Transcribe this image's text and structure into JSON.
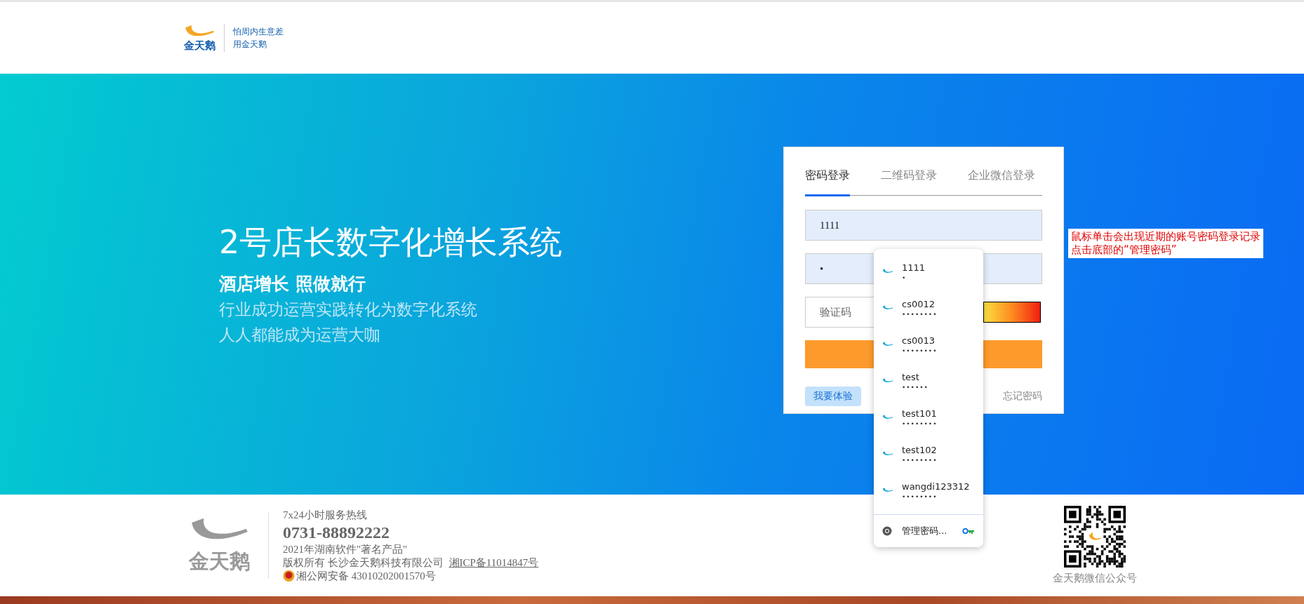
{
  "header": {
    "logo_text": "金天鹅",
    "slogan_lines": [
      "怕周内生意差",
      "用金天鹅"
    ]
  },
  "hero": {
    "title": "2号店长数字化增长系统",
    "subtitle": "酒店增长 照做就行",
    "lines": [
      "行业成功运营实践转化为数字化系统",
      "人人都能成为运营大咖"
    ]
  },
  "login": {
    "tabs": [
      {
        "label": "密码登录",
        "selected": true
      },
      {
        "label": "二维码登录",
        "selected": false
      },
      {
        "label": "企业微信登录",
        "selected": false
      }
    ],
    "username": {
      "value": "1111"
    },
    "password": {
      "value": "•"
    },
    "captcha": {
      "placeholder": "验证码"
    },
    "trial_button": "我要体验",
    "forgot_link": "忘记密码"
  },
  "autofill": {
    "items": [
      {
        "username": "1111",
        "password": "•"
      },
      {
        "username": "cs0012",
        "password": "••••••••"
      },
      {
        "username": "cs0013",
        "password": "••••••••"
      },
      {
        "username": "test",
        "password": "••••••"
      },
      {
        "username": "test101",
        "password": "••••••••"
      },
      {
        "username": "test102",
        "password": "••••••••"
      },
      {
        "username": "wangdi123312",
        "password": "••••••••"
      }
    ],
    "manage": "管理密码..."
  },
  "annotation": [
    "鼠标单击会出现近期的账号密码登录记录",
    "点击底部的“管理密码”"
  ],
  "footer": {
    "logo_text": "金天鹅",
    "hotline_label": "7x24小时服务热线",
    "hotline": "0731-88892222",
    "award": "2021年湖南软件\"著名产品\"",
    "copyright": "版权所有 长沙金天鹅科技有限公司",
    "icp": "湘ICP备11014847号",
    "police": "湘公网安备 43010202001570号",
    "qr_caption": "金天鹅微信公众号"
  }
}
